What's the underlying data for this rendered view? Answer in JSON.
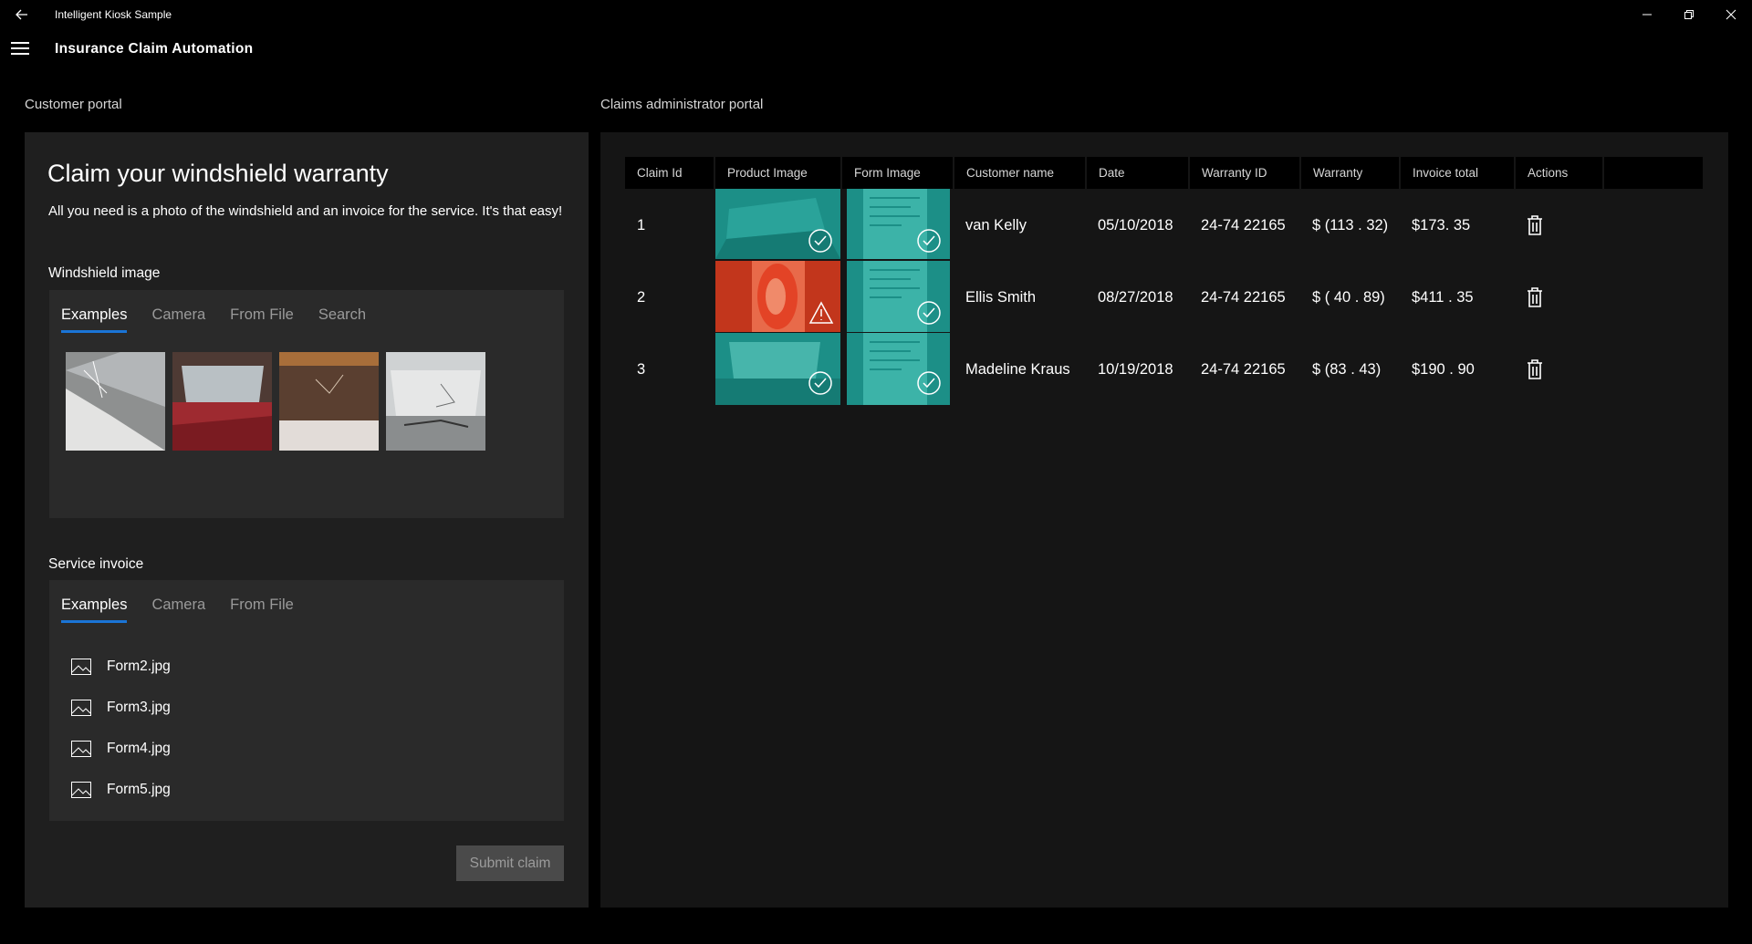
{
  "window": {
    "title": "Intelligent Kiosk Sample"
  },
  "header": {
    "title": "Insurance Claim Automation"
  },
  "customer": {
    "section_label": "Customer portal",
    "title": "Claim your windshield warranty",
    "description": "All you need is a photo of the windshield and an invoice for the service. It's that easy!",
    "windshield_label": "Windshield image",
    "windshield_tabs": [
      "Examples",
      "Camera",
      "From File",
      "Search"
    ],
    "invoice_label": "Service invoice",
    "invoice_tabs": [
      "Examples",
      "Camera",
      "From File"
    ],
    "invoice_files": [
      "Form2.jpg",
      "Form3.jpg",
      "Form4.jpg",
      "Form5.jpg"
    ],
    "submit_label": "Submit claim"
  },
  "admin": {
    "section_label": "Claims administrator portal",
    "columns": [
      "Claim Id",
      "Product Image",
      "Form Image",
      "Customer name",
      "Date",
      "Warranty ID",
      "Warranty",
      "Invoice total",
      "Actions"
    ],
    "rows": [
      {
        "id": "1",
        "customer": "van Kelly",
        "date": "05/10/2018",
        "warranty_id": "24-74 22165",
        "warranty": "$ (113 . 32)",
        "invoice": "$173. 35",
        "product_status": "ok",
        "form_status": "ok"
      },
      {
        "id": "2",
        "customer": "Ellis Smith",
        "date": "08/27/2018",
        "warranty_id": "24-74 22165",
        "warranty": "$ ( 40 . 89)",
        "invoice": "$411 . 35",
        "product_status": "warning",
        "form_status": "ok"
      },
      {
        "id": "3",
        "customer": "Madeline Kraus",
        "date": "10/19/2018",
        "warranty_id": "24-74 22165",
        "warranty": "$ (83 . 43)",
        "invoice": "$190 . 90",
        "product_status": "ok",
        "form_status": "ok"
      }
    ]
  },
  "colors": {
    "accent": "#1a74d6",
    "ok_tint": "#1c8f87",
    "warning_tint": "#c2361c"
  }
}
